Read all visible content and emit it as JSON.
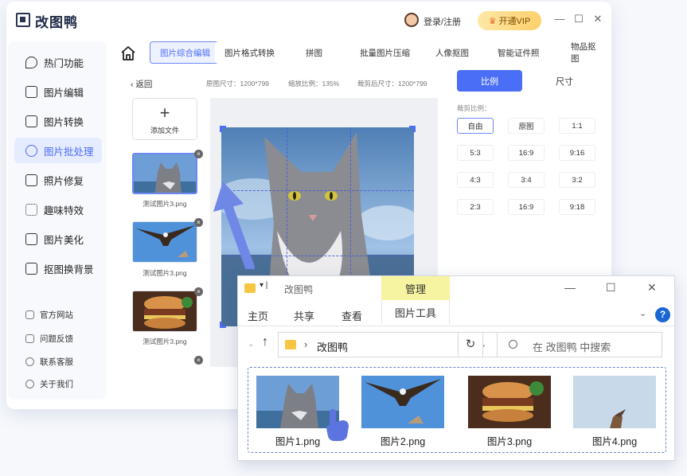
{
  "app": {
    "title": "改图鸭",
    "login": "登录/注册",
    "vip": "开通VIP",
    "sidebar": [
      {
        "label": "热门功能",
        "icon": "fire-icon"
      },
      {
        "label": "图片编辑",
        "icon": "image-edit-icon"
      },
      {
        "label": "图片转换",
        "icon": "convert-icon"
      },
      {
        "label": "图片批处理",
        "icon": "batch-icon"
      },
      {
        "label": "照片修复",
        "icon": "repair-icon"
      },
      {
        "label": "趣味特效",
        "icon": "effect-icon"
      },
      {
        "label": "图片美化",
        "icon": "beautify-icon"
      },
      {
        "label": "抠图换背景",
        "icon": "cutout-icon"
      }
    ],
    "sidebar_links": [
      {
        "label": "官方网站",
        "icon": "website-icon"
      },
      {
        "label": "问题反馈",
        "icon": "feedback-icon"
      },
      {
        "label": "联系客服",
        "icon": "support-icon"
      },
      {
        "label": "关于我们",
        "icon": "info-icon"
      }
    ],
    "tabs": [
      "图片综合编辑",
      "图片格式转换",
      "拼图",
      "批量图片压缩",
      "人像抠图",
      "智能证件照",
      "物品抠图"
    ],
    "back": "返回",
    "info": {
      "original_size": "原图尺寸：1200*799",
      "zoom": "缩放比例：135%",
      "cropped_size": "裁剪后尺寸：1200*799"
    },
    "add_file": "添加文件",
    "thumb_labels": [
      "测试图片3.png",
      "测试图片3.png",
      "测试图片3.png"
    ],
    "ratio_panel": {
      "ratio_tab": "比例",
      "size_tab": "尺寸",
      "crop_ratio_label": "裁剪比例：",
      "options": [
        "自由",
        "原图",
        "1:1",
        "5:3",
        "16:9",
        "9:16",
        "4:3",
        "3:4",
        "3:2",
        "2:3",
        "16:9",
        "9:18"
      ],
      "selected": "自由"
    }
  },
  "explorer": {
    "title": "改图鸭",
    "manage": "管理",
    "ribbon": [
      "主页",
      "共享",
      "查看"
    ],
    "picture_tools": "图片工具",
    "address": "改图鸭",
    "search_placeholder": "在 改图鸭 中搜索",
    "files": [
      "图片1.png",
      "图片2.png",
      "图片3.png",
      "图片4.png"
    ]
  }
}
